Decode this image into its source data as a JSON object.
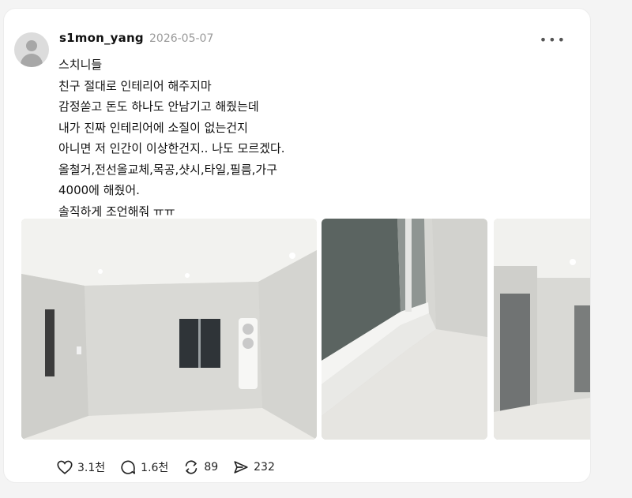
{
  "post": {
    "username": "s1mon_yang",
    "date": "2026-05-07",
    "more_icon": "more-icon",
    "lines": [
      "스치니들",
      "친구 절대로 인테리어 해주지마",
      "감정쏟고 돈도 하나도 안남기고 해줬는데",
      "내가 진짜 인테리어에 소질이 없는건지",
      "아니면 저 인간이 이상한건지.. 나도 모르겠다.",
      "올철거,전선올교체,목공,샷시,타일,필름,가구",
      "4000에 해줬어.",
      "솔직하게 조언해줘 ㅠㅠ"
    ]
  },
  "actions": {
    "likes": "3.1천",
    "replies": "1.6천",
    "reposts": "89",
    "shares": "232"
  },
  "colors": {
    "accent_text": "#111111",
    "muted_text": "#9a9a9a",
    "card_bg": "#ffffff"
  }
}
